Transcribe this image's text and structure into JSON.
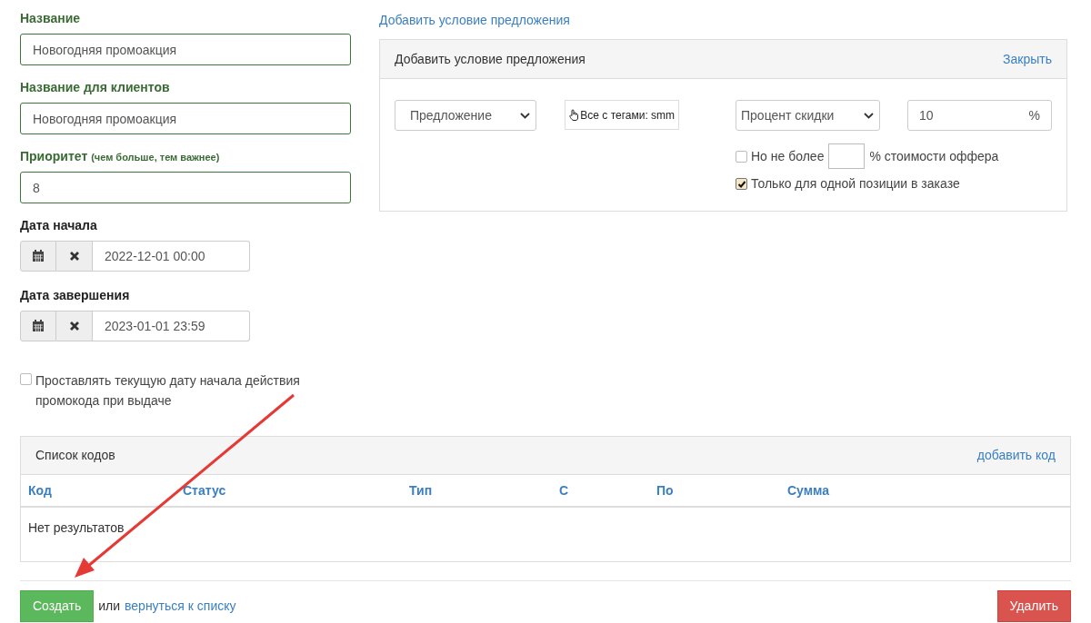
{
  "fields": [
    {
      "label": "Название",
      "value": "Новогодняя промоакция"
    },
    {
      "label": "Название для клиентов",
      "value": "Новогодняя промоакция"
    },
    {
      "label": "Приоритет",
      "hint": "(чем больше, тем важнее)",
      "value": "8"
    }
  ],
  "dates": [
    {
      "label": "Дата начала",
      "value": "2022-12-01 00:00"
    },
    {
      "label": "Дата завершения",
      "value": "2023-01-01 23:59"
    }
  ],
  "auto_date": {
    "label": "Проставлять текущую дату начала действия промокода при выдаче",
    "checked": false
  },
  "offer": {
    "add_link": "Добавить условие предложения",
    "panel_title": "Добавить условие предложения",
    "close_link": "Закрыть",
    "target_select": "Предложение",
    "tags_button": "Все с тегами: smm",
    "discount_select": "Процент скидки",
    "discount_value": "10",
    "discount_unit": "%",
    "limit": {
      "checked": false,
      "before": "Но не более",
      "after": "% стоимости оффера"
    },
    "single": {
      "checked": true,
      "label": "Только для одной позиции в заказе"
    }
  },
  "codes": {
    "title": "Список кодов",
    "add_link": "добавить код",
    "columns": [
      "Код",
      "Статус",
      "Тип",
      "С",
      "По",
      "Сумма"
    ],
    "empty": "Нет результатов"
  },
  "footer": {
    "create": "Создать",
    "or": "или",
    "back": "вернуться к списку",
    "delete": "Удалить"
  }
}
